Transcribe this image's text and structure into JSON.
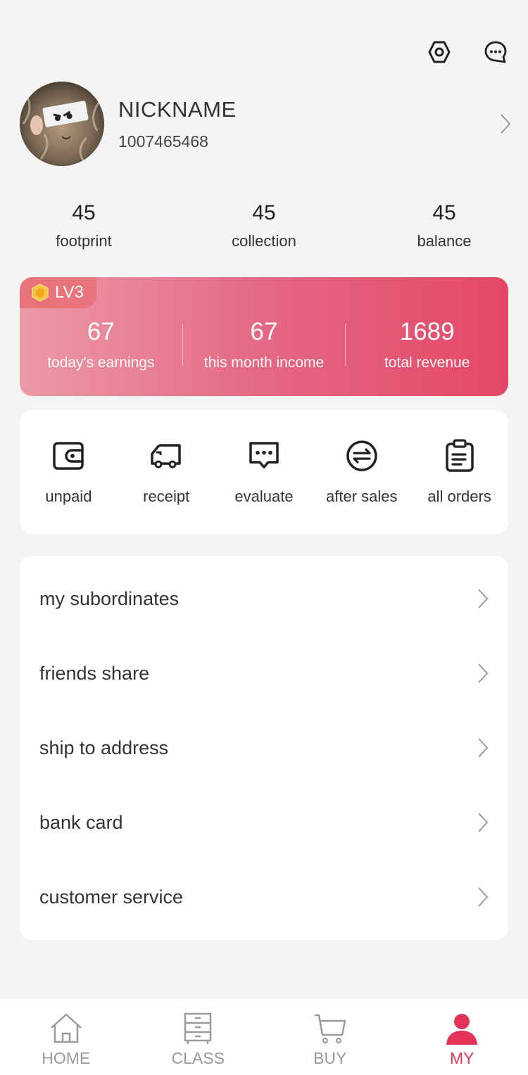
{
  "colors": {
    "accent": "#e3355c",
    "card_gradient_start": "#ec9aa7",
    "card_gradient_end": "#e54766",
    "background": "#f4f4f4"
  },
  "header": {
    "icons": [
      "settings-hexagon-icon",
      "message-bubble-icon"
    ]
  },
  "profile": {
    "nickname": "NICKNAME",
    "user_id": "1007465468"
  },
  "stats": [
    {
      "value": "45",
      "label": "footprint"
    },
    {
      "value": "45",
      "label": "collection"
    },
    {
      "value": "45",
      "label": "balance"
    }
  ],
  "earnings": {
    "level": "LV3",
    "items": [
      {
        "value": "67",
        "label": "today's earnings"
      },
      {
        "value": "67",
        "label": "this month income"
      },
      {
        "value": "1689",
        "label": "total revenue"
      }
    ]
  },
  "orders": [
    {
      "label": "unpaid",
      "icon": "wallet-icon"
    },
    {
      "label": "receipt",
      "icon": "truck-icon"
    },
    {
      "label": "evaluate",
      "icon": "comment-icon"
    },
    {
      "label": "after sales",
      "icon": "exchange-icon"
    },
    {
      "label": "all orders",
      "icon": "clipboard-icon"
    }
  ],
  "menu": [
    {
      "label": "my subordinates"
    },
    {
      "label": "friends share"
    },
    {
      "label": "ship to address"
    },
    {
      "label": "bank card"
    },
    {
      "label": "customer service"
    }
  ],
  "tabbar": [
    {
      "label": "HOME",
      "icon": "home-icon",
      "active": false
    },
    {
      "label": "CLASS",
      "icon": "cabinet-icon",
      "active": false
    },
    {
      "label": "BUY",
      "icon": "cart-icon",
      "active": false
    },
    {
      "label": "MY",
      "icon": "user-icon",
      "active": true
    }
  ]
}
